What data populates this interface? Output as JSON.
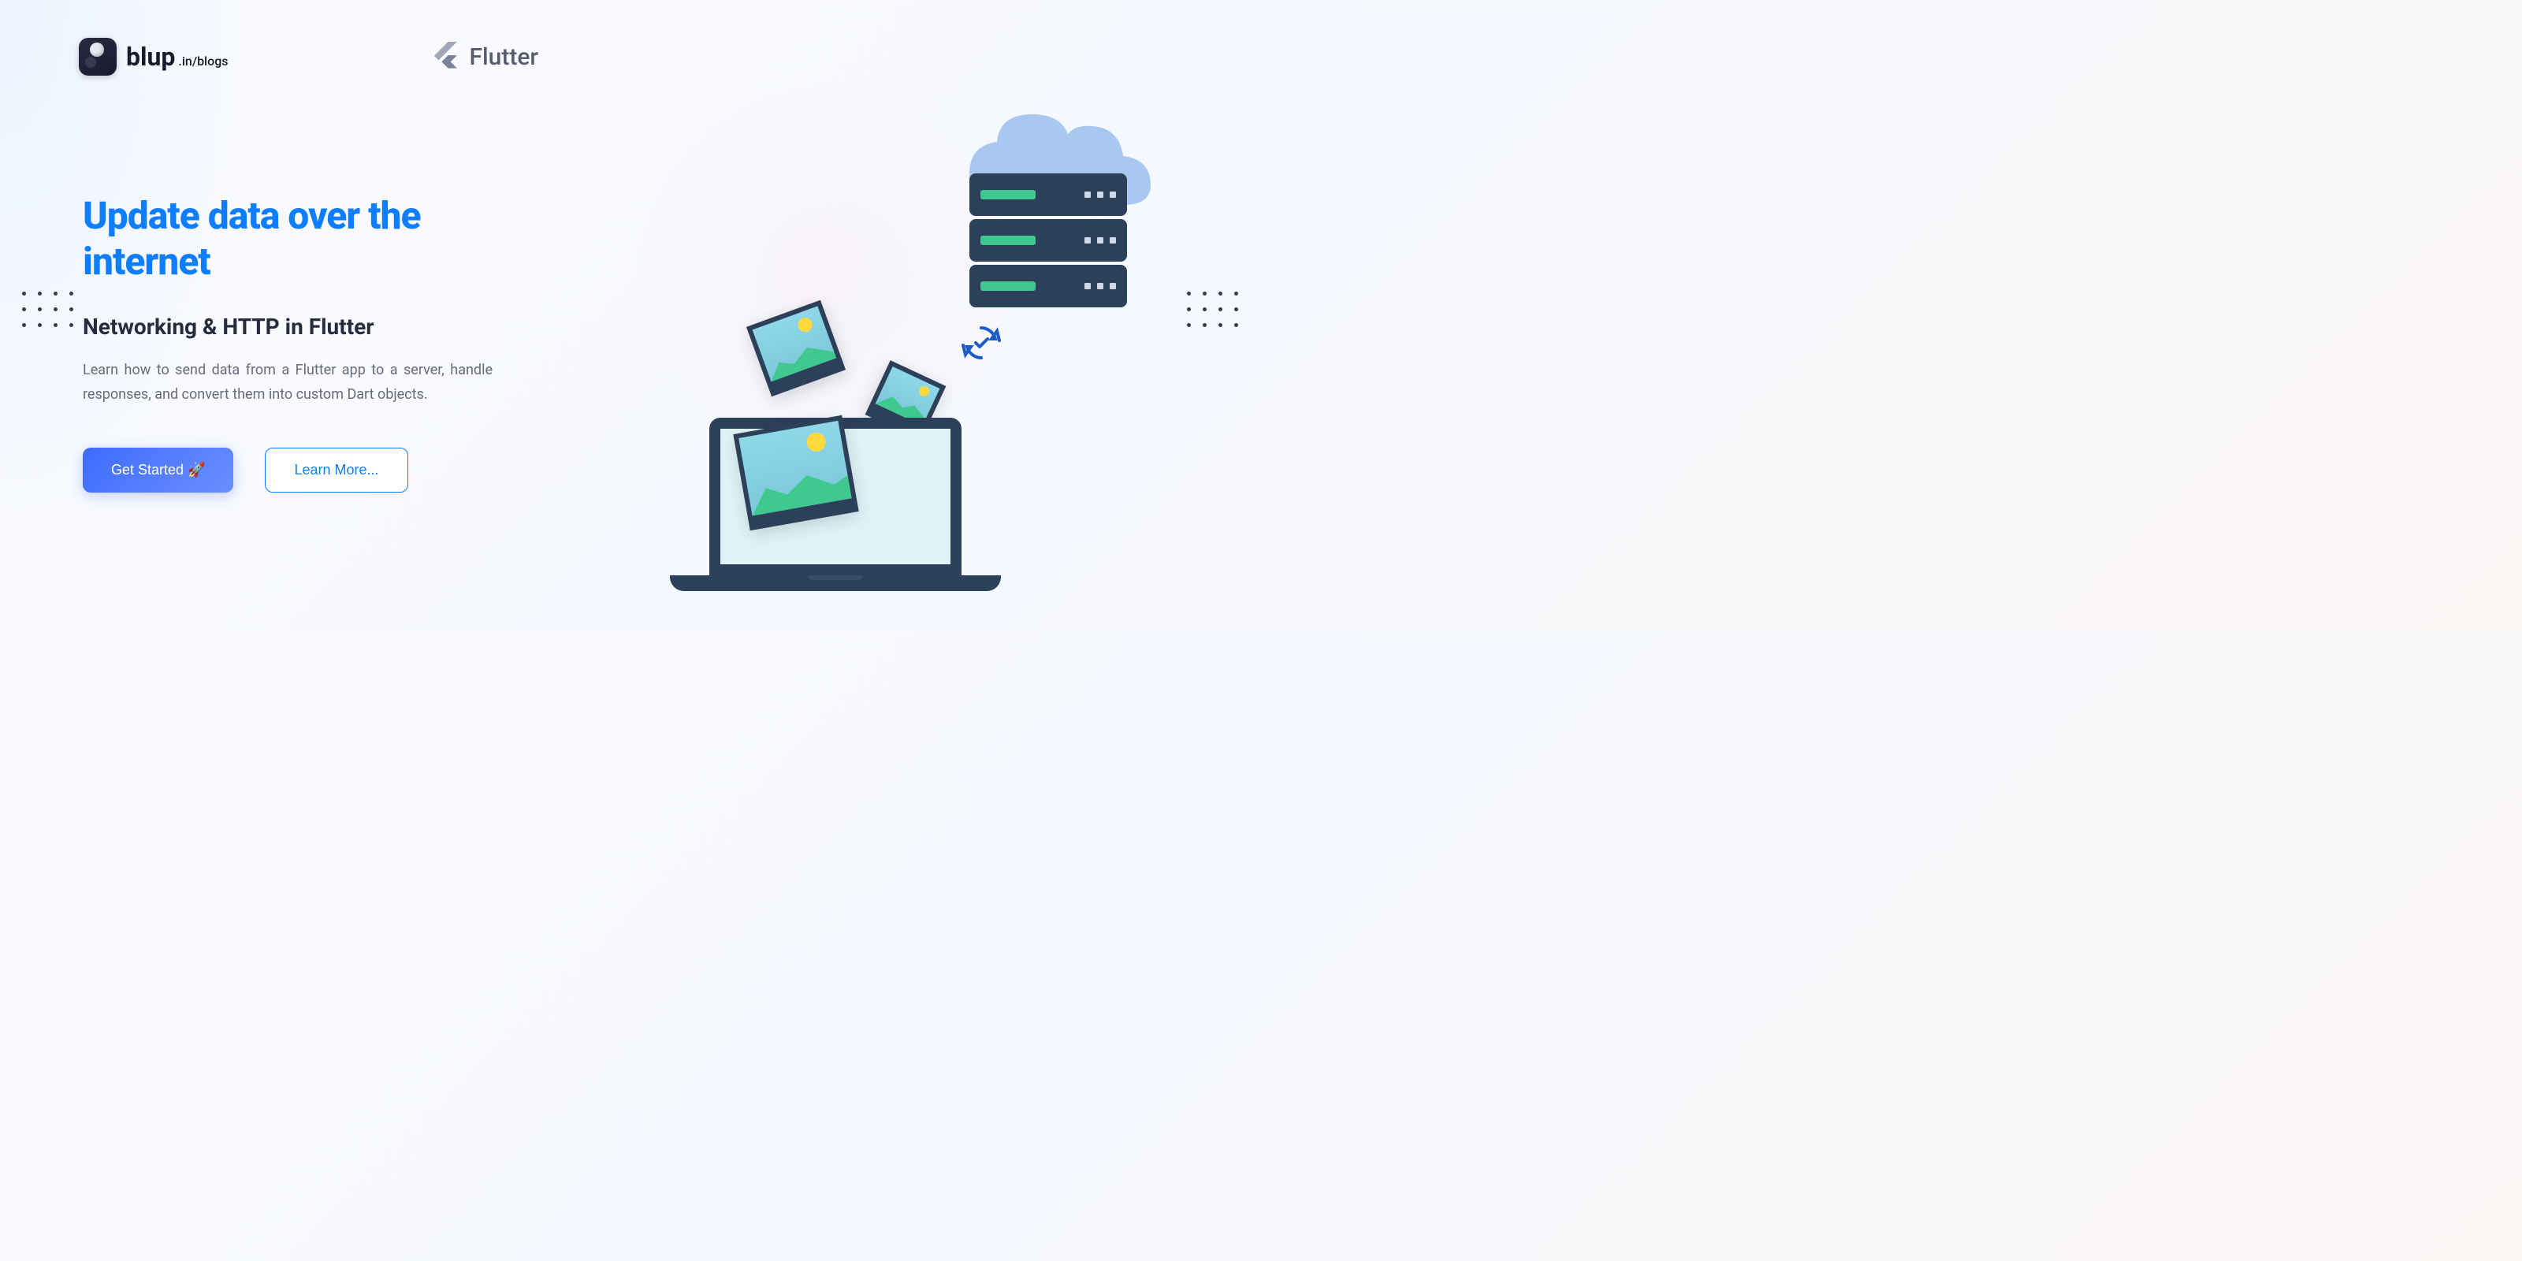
{
  "logo": {
    "brand": "blup",
    "path": ".in/blogs"
  },
  "platform": {
    "name": "Flutter"
  },
  "hero": {
    "title": "Update data over the internet",
    "subtitle": "Networking & HTTP in Flutter",
    "description": "Learn how to send data from a Flutter app to a server, handle responses, and convert them into custom Dart objects."
  },
  "buttons": {
    "primary": "Get Started 🚀",
    "secondary": "Learn More..."
  },
  "colors": {
    "accent": "#0e7eff",
    "primary_button": "#3d6bff",
    "server_green": "#3fc98e",
    "dark": "#2d4059"
  }
}
